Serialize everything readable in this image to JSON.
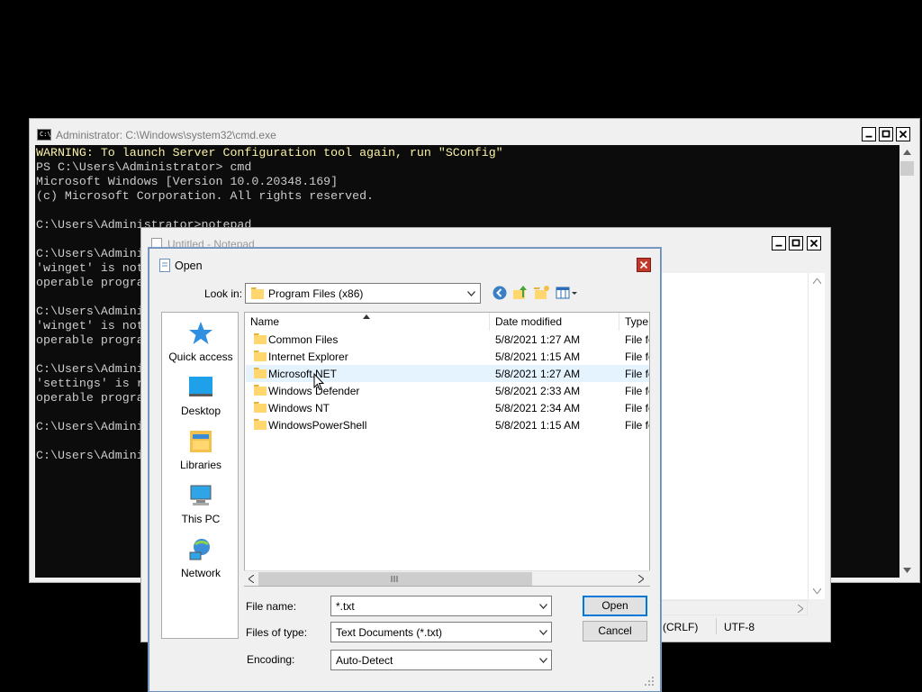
{
  "cmd": {
    "title": "Administrator: C:\\Windows\\system32\\cmd.exe",
    "lines": [
      "WARNING: To launch Server Configuration tool again, run \"SConfig\"",
      "PS C:\\Users\\Administrator> cmd",
      "Microsoft Windows [Version 10.0.20348.169]",
      "(c) Microsoft Corporation. All rights reserved.",
      "",
      "C:\\Users\\Administrator>notepad",
      "",
      "C:\\Users\\Admini",
      "'winget' is not",
      "operable progra",
      "",
      "C:\\Users\\Admini",
      "'winget' is not",
      "operable progra",
      "",
      "C:\\Users\\Admini",
      "'settings' is r",
      "operable progra",
      "",
      "C:\\Users\\Admini",
      "",
      "C:\\Users\\Admini"
    ],
    "warning_color": "#f9f1a5"
  },
  "notepad": {
    "title": "Untitled - Notepad",
    "status_line_ending": "(CRLF)",
    "status_encoding": "UTF-8"
  },
  "dialog": {
    "title": "Open",
    "look_in_label": "Look in:",
    "look_in_value": "Program Files (x86)",
    "places": [
      {
        "label": "Quick access",
        "icon": "quick-access-star-icon"
      },
      {
        "label": "Desktop",
        "icon": "desktop-icon"
      },
      {
        "label": "Libraries",
        "icon": "libraries-icon"
      },
      {
        "label": "This PC",
        "icon": "this-pc-icon"
      },
      {
        "label": "Network",
        "icon": "network-icon"
      }
    ],
    "columns": {
      "name": "Name",
      "date": "Date modified",
      "type": "Type"
    },
    "files": [
      {
        "name": "Common Files",
        "date": "5/8/2021 1:27 AM",
        "type": "File fo"
      },
      {
        "name": "Internet Explorer",
        "date": "5/8/2021 1:15 AM",
        "type": "File fo"
      },
      {
        "name": "Microsoft.NET",
        "date": "5/8/2021 1:27 AM",
        "type": "File fo"
      },
      {
        "name": "Windows Defender",
        "date": "5/8/2021 2:33 AM",
        "type": "File fo"
      },
      {
        "name": "Windows NT",
        "date": "5/8/2021 2:34 AM",
        "type": "File fo"
      },
      {
        "name": "WindowsPowerShell",
        "date": "5/8/2021 1:15 AM",
        "type": "File fo"
      }
    ],
    "file_name_label": "File name:",
    "file_name_value": "*.txt",
    "file_type_label": "Files of type:",
    "file_type_value": "Text Documents (*.txt)",
    "encoding_label": "Encoding:",
    "encoding_value": "Auto-Detect",
    "open_button": "Open",
    "cancel_button": "Cancel"
  },
  "colors": {
    "folder": "#ffd76e",
    "accent": "#0078d7",
    "close_red": "#c42b1c"
  }
}
